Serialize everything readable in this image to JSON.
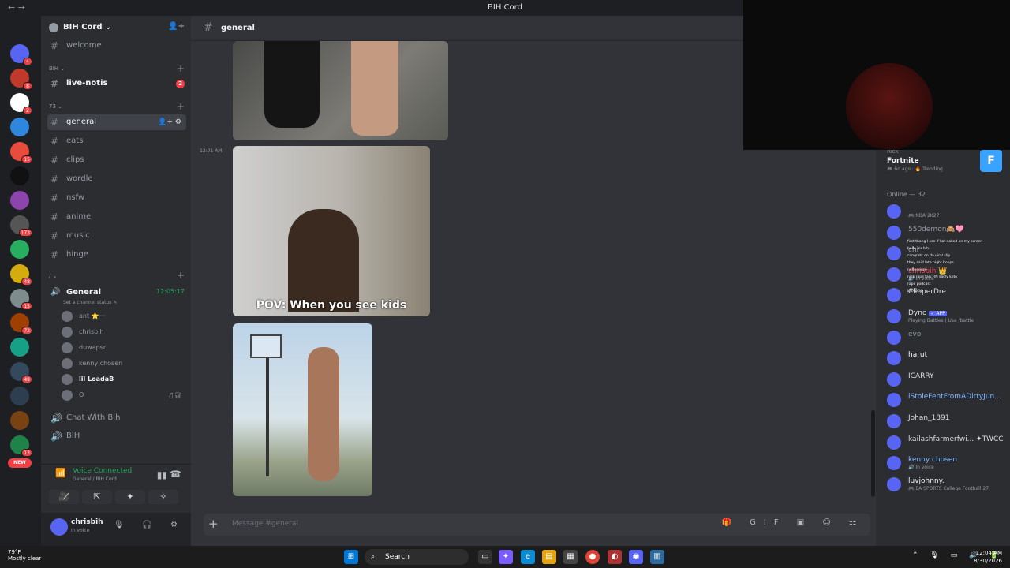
{
  "window": {
    "title": "BIH Cord",
    "nav_back": "←",
    "nav_forward": "→"
  },
  "servers": [
    {
      "badge": "4",
      "color": "#5865f2"
    },
    {
      "badge": "8",
      "color": "#c0392b"
    },
    {
      "badge": "2",
      "color": "#ffffff"
    },
    {
      "badge": "",
      "color": "#2e86de"
    },
    {
      "badge": "15",
      "color": "#e74c3c"
    },
    {
      "badge": "",
      "color": "#111111"
    },
    {
      "badge": "",
      "color": "#8e44ad"
    },
    {
      "badge": "173",
      "color": "#555555"
    },
    {
      "badge": "",
      "color": "#27ae60"
    },
    {
      "badge": "48",
      "color": "#d4ac0d"
    },
    {
      "badge": "15",
      "color": "#7f8c8d"
    },
    {
      "badge": "72",
      "color": "#a04000"
    },
    {
      "badge": "",
      "color": "#16a085"
    },
    {
      "badge": "49",
      "color": "#34495e"
    },
    {
      "badge": "",
      "color": "#2c3e50"
    },
    {
      "badge": "",
      "color": "#784212"
    },
    {
      "badge": "13",
      "color": "#1d8348"
    }
  ],
  "servers_new_label": "NEW",
  "guild": {
    "name": "BIH Cord ⌄"
  },
  "channels_top": [
    {
      "name": "welcome"
    }
  ],
  "category_bih": "BIH ⌄",
  "channel_livenotis": {
    "name": "live-notis",
    "badge": "2"
  },
  "category_73": "73 ⌄",
  "text_channels": [
    {
      "name": "general",
      "active": true,
      "actions": "👤+ ⚙"
    },
    {
      "name": "eats"
    },
    {
      "name": "clips"
    },
    {
      "name": "wordle"
    },
    {
      "name": "nsfw"
    },
    {
      "name": "anime"
    },
    {
      "name": "music"
    },
    {
      "name": "hinge"
    }
  ],
  "category_slash": "/ ⌄",
  "voice_channel": {
    "name": "General",
    "timer": "12:05:17",
    "status": "Set a channel status ✎"
  },
  "voice_users": [
    {
      "name": "ant ⭐···"
    },
    {
      "name": "chrisbih"
    },
    {
      "name": "duwapsr"
    },
    {
      "name": "kenny chosen"
    },
    {
      "name": "lil LoadaB",
      "bold": true
    },
    {
      "name": "O",
      "icons": "🎙̸ 🎧̸"
    }
  ],
  "voice_channels_other": [
    {
      "name": "Chat With Bih"
    },
    {
      "name": "BIH"
    }
  ],
  "voice_panel": {
    "title": "Voice Connected",
    "sub": "General / BIH Cord",
    "buttons": [
      "🎥̸",
      "⇱",
      "✦",
      "✧"
    ]
  },
  "user_panel": {
    "name": "chrisbih",
    "status": "In voice"
  },
  "header": {
    "channel": "general"
  },
  "messages": {
    "timestamp": "12:01 AM",
    "caption": "POV: When you see kids"
  },
  "composer": {
    "placeholder": "Message #general",
    "tools": "🎁 GIF ▣ ☺ ⚏"
  },
  "activity": {
    "user": "Rick",
    "game": "Fortnite",
    "meta": "🎮 6d ago · 🔥 Trending",
    "icon_letter": "F"
  },
  "online_header": "Online — 32",
  "members": [
    {
      "name": "",
      "activity": "🎮 NBA 2K27",
      "color": "#f23f43"
    },
    {
      "name": "550demon🙈🩷",
      "activity": "",
      "color": "#949ba4"
    },
    {
      "name": "chi",
      "activity": "",
      "color": "#949ba4"
    },
    {
      "name": "chrisbih 👑",
      "activity": "🔊 In voice",
      "color": "#f23f43"
    },
    {
      "name": "ClipperDre",
      "activity": "",
      "color": "#dbdee1"
    },
    {
      "name": "Dyno",
      "bot": "✓ APP",
      "activity": "Playing Battles | Use /battle",
      "color": "#dbdee1"
    },
    {
      "name": "evo",
      "activity": "",
      "color": "#949ba4"
    },
    {
      "name": "harut",
      "activity": "",
      "color": "#f2f3f5"
    },
    {
      "name": "ICARRY",
      "activity": "",
      "color": "#dbdee1"
    },
    {
      "name": "iStoleFentFromADirtyJun...",
      "activity": "",
      "color": "#80b7ff"
    },
    {
      "name": "Johan_1891",
      "activity": "",
      "color": "#dbdee1"
    },
    {
      "name": "kailashfarmerfwi... ✦TWCC",
      "activity": "",
      "color": "#dbdee1"
    },
    {
      "name": "kenny chosen",
      "activity": "🔊 In voice",
      "color": "#80b7ff"
    },
    {
      "name": "luvjohnny.",
      "activity": "🎮 EA SPORTS College Football 27",
      "color": "#f2f3f5"
    }
  ],
  "chat_overlay": [
    "first thang I see if kat naked on my screen",
    "hello mr bih",
    "congrats on da viral clip",
    "they said late night hoops",
    "nofleeeeze",
    "nick rape talk RN sadly keto",
    "rape podcast",
    "LMAOOO"
  ],
  "taskbar": {
    "weather_temp": "79°F",
    "weather_desc": "Mostly clear",
    "search": "Search",
    "time": "12:04 AM",
    "date": "8/30/2026",
    "tray": "⌃ 🎙 ▭ 🔊 🔋"
  }
}
